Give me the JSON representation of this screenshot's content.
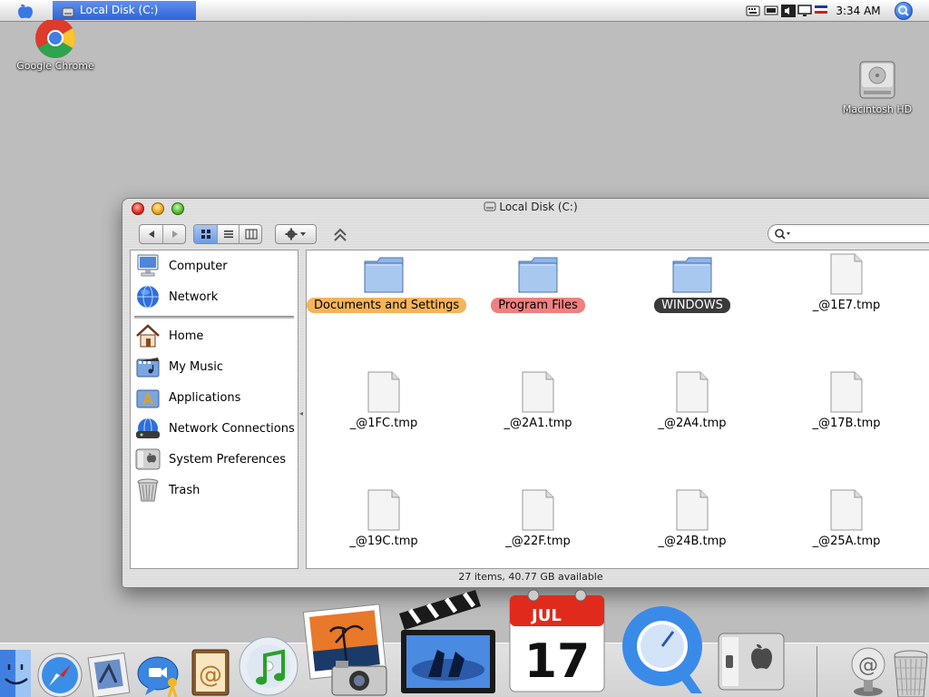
{
  "menubar": {
    "app_title": "Local Disk (C:)",
    "clock": "3:34 AM"
  },
  "desktop": {
    "icons": [
      {
        "label": "Google Chrome"
      },
      {
        "label": "Macintosh HD"
      }
    ]
  },
  "window": {
    "title": "Local Disk (C:)",
    "status": "27 items, 40.77 GB available",
    "search_placeholder": ""
  },
  "sidebar": {
    "items": [
      {
        "label": "Computer"
      },
      {
        "label": "Network"
      },
      {
        "label": "Home"
      },
      {
        "label": "My Music"
      },
      {
        "label": "Applications"
      },
      {
        "label": "Network Connections"
      },
      {
        "label": "System Preferences"
      },
      {
        "label": "Trash"
      }
    ]
  },
  "files": {
    "items": [
      {
        "label": "Documents and Settings",
        "kind": "folder",
        "tag": "orange"
      },
      {
        "label": "Program Files",
        "kind": "folder",
        "tag": "red"
      },
      {
        "label": "WINDOWS",
        "kind": "folder",
        "tag": "dark"
      },
      {
        "label": "_@1E7.tmp",
        "kind": "file"
      },
      {
        "label": "_@1FC.tmp",
        "kind": "file"
      },
      {
        "label": "_@2A1.tmp",
        "kind": "file"
      },
      {
        "label": "_@2A4.tmp",
        "kind": "file"
      },
      {
        "label": "_@17B.tmp",
        "kind": "file"
      },
      {
        "label": "_@19C.tmp",
        "kind": "file"
      },
      {
        "label": "_@22F.tmp",
        "kind": "file"
      },
      {
        "label": "_@24B.tmp",
        "kind": "file"
      },
      {
        "label": "_@25A.tmp",
        "kind": "file"
      }
    ]
  },
  "dock": {
    "calendar": {
      "month": "JUL",
      "day": "17"
    },
    "items": [
      {
        "name": "finder-icon"
      },
      {
        "name": "safari-icon"
      },
      {
        "name": "mail-icon"
      },
      {
        "name": "ichat-icon"
      },
      {
        "name": "address-book-icon"
      },
      {
        "name": "itunes-icon"
      },
      {
        "name": "iphoto-icon"
      },
      {
        "name": "imovie-icon"
      },
      {
        "name": "ical-icon"
      },
      {
        "name": "quicktime-icon"
      },
      {
        "name": "system-preferences-icon"
      },
      {
        "name": "mail-at-icon"
      },
      {
        "name": "trash-icon"
      }
    ]
  },
  "colors": {
    "selection_blue": "#2f63d6",
    "tag_orange": "#f5b45a",
    "tag_red": "#f08080",
    "tag_dark": "#3a3a3a"
  }
}
